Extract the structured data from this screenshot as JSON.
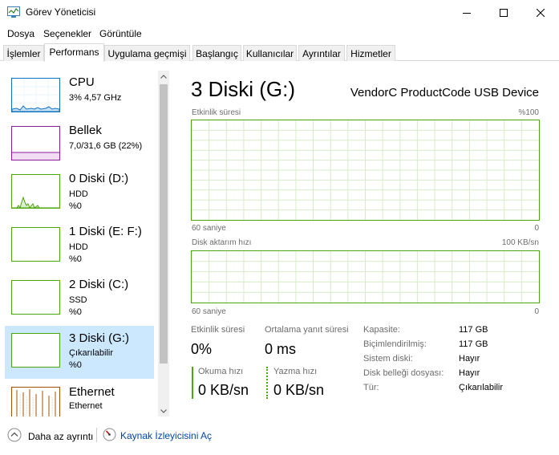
{
  "window": {
    "title": "Görev Yöneticisi",
    "icon": "task-manager-icon"
  },
  "menu": [
    "Dosya",
    "Seçenekler",
    "Görüntüle"
  ],
  "tabs": [
    "İşlemler",
    "Performans",
    "Uygulama geçmişi",
    "Başlangıç",
    "Kullanıcılar",
    "Ayrıntılar",
    "Hizmetler"
  ],
  "active_tab": "Performans",
  "sidebar": {
    "items": [
      {
        "name": "CPU",
        "line1": "3% 4,57 GHz",
        "line2": "",
        "color": "#1172be"
      },
      {
        "name": "Bellek",
        "line1": "7,0/31,6 GB (22%)",
        "line2": "",
        "color": "#8b1e9c"
      },
      {
        "name": "0 Diski (D:)",
        "line1": "HDD",
        "line2": "%0",
        "color": "#4da60c"
      },
      {
        "name": "1 Diski (E: F:)",
        "line1": "HDD",
        "line2": "%0",
        "color": "#4da60c"
      },
      {
        "name": "2 Diski (C:)",
        "line1": "SSD",
        "line2": "%0",
        "color": "#4da60c"
      },
      {
        "name": "3 Diski (G:)",
        "line1": "Çıkarılabilir",
        "line2": "%0",
        "color": "#4da60c",
        "selected": true
      },
      {
        "name": "Ethernet",
        "line1": "Ethernet",
        "line2": "",
        "color": "#a74f01"
      }
    ]
  },
  "main": {
    "title": "3 Diski (G:)",
    "device": "VendorC ProductCode USB Device",
    "graph1": {
      "label": "Etkinlik süresi",
      "max": "%100",
      "time": "60 saniye",
      "min": "0"
    },
    "graph2": {
      "label": "Disk aktarım hızı",
      "max": "100 KB/sn",
      "time": "60 saniye",
      "min": "0"
    },
    "stats": {
      "active_label": "Etkinlik süresi",
      "active_value": "0%",
      "response_label": "Ortalama yanıt süresi",
      "response_value": "0 ms",
      "read_label": "Okuma hızı",
      "read_value": "0 KB/sn",
      "write_label": "Yazma hızı",
      "write_value": "0 KB/sn"
    },
    "properties": [
      {
        "label": "Kapasite:",
        "value": "117 GB"
      },
      {
        "label": "Biçimlendirilmiş:",
        "value": "117 GB"
      },
      {
        "label": "Sistem diski:",
        "value": "Hayır"
      },
      {
        "label": "Disk belleği dosyası:",
        "value": "Hayır"
      },
      {
        "label": "Tür:",
        "value": "Çıkarılabilir"
      }
    ],
    "accent_color": "#4da60c"
  },
  "footer": {
    "less_details": "Daha az ayrıntı",
    "resource_monitor": "Kaynak İzleyicisini Aç"
  }
}
